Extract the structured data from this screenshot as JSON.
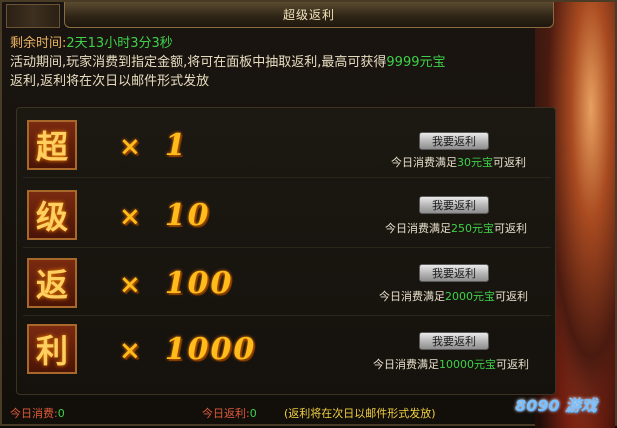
{
  "window": {
    "title": "超级返利"
  },
  "info": {
    "remaining_label": "剩余时间:",
    "remaining_value": "2天13小时3分3秒",
    "desc_prefix": "活动期间,玩家消费到指定金额,将可在面板中抽取返利,最高可获得",
    "desc_max": "9999元宝",
    "desc_line2": "返利,返利将在次日以邮件形式发放"
  },
  "rows": [
    {
      "char": "超",
      "multiplier": "1",
      "button": "我要返利",
      "cond_prefix": "今日消费满足",
      "cond_amount": "30元宝",
      "cond_suffix": "可返利"
    },
    {
      "char": "级",
      "multiplier": "10",
      "button": "我要返利",
      "cond_prefix": "今日消费满足",
      "cond_amount": "250元宝",
      "cond_suffix": "可返利"
    },
    {
      "char": "返",
      "multiplier": "100",
      "button": "我要返利",
      "cond_prefix": "今日消费满足",
      "cond_amount": "2000元宝",
      "cond_suffix": "可返利"
    },
    {
      "char": "利",
      "multiplier": "1000",
      "button": "我要返利",
      "cond_prefix": "今日消费满足",
      "cond_amount": "10000元宝",
      "cond_suffix": "可返利"
    }
  ],
  "footer": {
    "spent_label": "今日消费:",
    "spent_value": "0",
    "rebate_label": "今日返利:",
    "rebate_value": "0",
    "note": "(返利将在次日以邮件形式发放)"
  },
  "logo": {
    "text": "8090 游戏"
  }
}
